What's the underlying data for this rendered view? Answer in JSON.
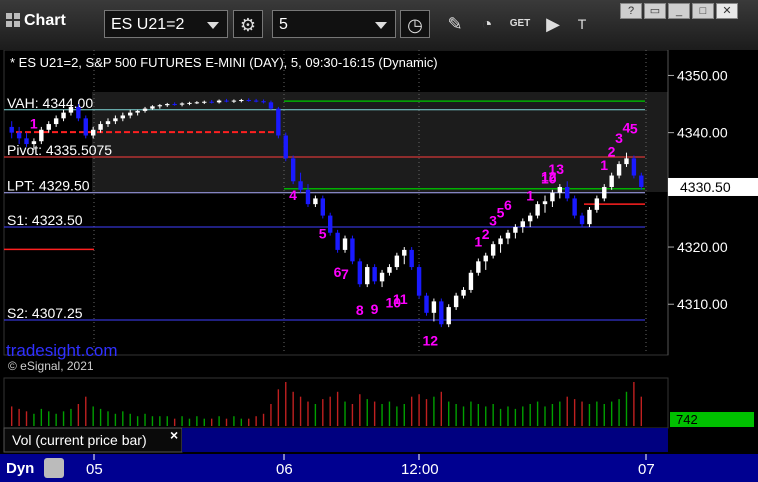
{
  "toolbar": {
    "title": "Chart",
    "symbol": "ES U21=2",
    "interval": "5",
    "icons": [
      "settings-gear-icon",
      "clock-icon",
      "draw-pen-icon",
      "indicator-icon",
      "get-icon",
      "play-icon",
      "text-tool-icon"
    ],
    "window_buttons": [
      "restore-icon",
      "tile-icon",
      "minimize-icon",
      "close-icon"
    ]
  },
  "chart_header": "* ES U21=2, S&P 500 FUTURES E-MINI (DAY), 5, 09:30-16:15 (Dynamic)",
  "watermark": "tradesight.com",
  "copyright": "© eSignal, 2021",
  "vol_panel_label": "Vol (current price bar)",
  "vol_value": "742",
  "bottom_bar_label": "Dyn",
  "x_axis_labels": [
    "05",
    "06",
    "12:00",
    "07"
  ],
  "colors": {
    "up": "#ffffff",
    "down": "#1a1aff",
    "pink": "#ff00ff",
    "green": "#009000",
    "bg": "#000000"
  },
  "chart_data": {
    "type": "candlestick",
    "title": "ES U21=2, S&P 500 FUTURES E-MINI (DAY), 5, 09:30-16:15 (Dynamic)",
    "ylim": [
      4302,
      4352
    ],
    "y_ticks": [
      4310.0,
      4320.0,
      4330.0,
      4340.0,
      4350.0
    ],
    "last_price": 4330.5,
    "levels": [
      {
        "label": "VAH: 4344.00",
        "value": 4344.0,
        "color": "#7fd6d6"
      },
      {
        "label": "Pivot: 4335.5075",
        "value": 4335.75,
        "color": "#ff3c3c"
      },
      {
        "label": "LPT: 4329.50",
        "value": 4329.5,
        "color": "#b0b0ff"
      },
      {
        "label": "S1: 4323.50",
        "value": 4323.5,
        "color": "#4040ff"
      },
      {
        "label": "S2: 4307.25",
        "value": 4307.25,
        "color": "#4040ff"
      }
    ],
    "extra_lines": [
      {
        "value": 4345.5,
        "color": "#00b000"
      },
      {
        "value": 4330.2,
        "color": "#00b000"
      },
      {
        "value": 4319.6,
        "color": "#ff2020"
      },
      {
        "value": 4340.1,
        "color": "#ff2020"
      },
      {
        "value": 4327.5,
        "color": "#ff2020"
      }
    ],
    "candles": [
      [
        4341,
        4342,
        4339,
        4340
      ],
      [
        4340,
        4341,
        4338,
        4339
      ],
      [
        4339,
        4340,
        4337.5,
        4338
      ],
      [
        4338,
        4339,
        4337,
        4338.5
      ],
      [
        4338.5,
        4341,
        4338,
        4340.5
      ],
      [
        4340.5,
        4342,
        4340,
        4341.5
      ],
      [
        4341.5,
        4343,
        4341,
        4342.5
      ],
      [
        4342.5,
        4344,
        4342,
        4343.5
      ],
      [
        4343.5,
        4345,
        4343,
        4344.5
      ],
      [
        4344.5,
        4345,
        4342,
        4342.5
      ],
      [
        4342.5,
        4343,
        4339,
        4339.5
      ],
      [
        4339.5,
        4341,
        4339,
        4340.5
      ],
      [
        4340.5,
        4342,
        4340,
        4341.5
      ],
      [
        4341.5,
        4342.5,
        4341,
        4342
      ],
      [
        4342,
        4343,
        4341.5,
        4342.5
      ],
      [
        4342.5,
        4343.5,
        4342,
        4343
      ],
      [
        4343,
        4344,
        4342.5,
        4343.5
      ],
      [
        4343.5,
        4344,
        4343,
        4343.8
      ],
      [
        4343.8,
        4344.5,
        4343.5,
        4344.2
      ],
      [
        4344.2,
        4344.8,
        4344,
        4344.6
      ],
      [
        4344.6,
        4345,
        4344.2,
        4344.8
      ],
      [
        4344.8,
        4345.2,
        4344.5,
        4345
      ],
      [
        4345,
        4345.3,
        4344.7,
        4344.9
      ],
      [
        4344.9,
        4345.3,
        4344.6,
        4345.1
      ],
      [
        4345.1,
        4345.4,
        4344.8,
        4345.2
      ],
      [
        4345.2,
        4345.5,
        4345,
        4345.3
      ],
      [
        4345.3,
        4345.6,
        4345,
        4345.4
      ],
      [
        4345.4,
        4345.7,
        4345.1,
        4345.3
      ],
      [
        4345.3,
        4345.8,
        4345.1,
        4345.6
      ],
      [
        4345.6,
        4345.9,
        4345.3,
        4345.5
      ],
      [
        4345.5,
        4345.8,
        4345.2,
        4345.6
      ],
      [
        4345.6,
        4345.9,
        4345.3,
        4345.7
      ],
      [
        4345.7,
        4346,
        4345.4,
        4345.6
      ],
      [
        4345.6,
        4345.9,
        4345.3,
        4345.5
      ],
      [
        4345.5,
        4345.8,
        4345.1,
        4345.3
      ],
      [
        4345.3,
        4345.6,
        4344,
        4344.2
      ],
      [
        4344.2,
        4344.5,
        4339,
        4339.5
      ],
      [
        4339.5,
        4340,
        4335,
        4335.5
      ],
      [
        4335.5,
        4336,
        4331,
        4331.5
      ],
      [
        4331.5,
        4333,
        4329.5,
        4330
      ],
      [
        4330,
        4331,
        4327,
        4327.5
      ],
      [
        4327.5,
        4329,
        4327,
        4328.5
      ],
      [
        4328.5,
        4329,
        4325,
        4325.5
      ],
      [
        4325.5,
        4326,
        4322,
        4322.5
      ],
      [
        4322.5,
        4323,
        4319,
        4319.5
      ],
      [
        4319.5,
        4322,
        4319,
        4321.5
      ],
      [
        4321.5,
        4322,
        4317,
        4317.5
      ],
      [
        4317.5,
        4318,
        4313,
        4313.5
      ],
      [
        4313.5,
        4317,
        4313,
        4316.5
      ],
      [
        4316.5,
        4317,
        4313.5,
        4314
      ],
      [
        4314,
        4316,
        4313,
        4315.5
      ],
      [
        4315.5,
        4317,
        4315,
        4316.5
      ],
      [
        4316.5,
        4319,
        4316,
        4318.5
      ],
      [
        4318.5,
        4320,
        4317,
        4319.5
      ],
      [
        4319.5,
        4320,
        4316,
        4316.5
      ],
      [
        4316.5,
        4317,
        4311,
        4311.5
      ],
      [
        4311.5,
        4312,
        4308,
        4308.5
      ],
      [
        4308.5,
        4311,
        4307,
        4310.5
      ],
      [
        4310.5,
        4311,
        4306,
        4306.5
      ],
      [
        4306.5,
        4310,
        4306,
        4309.5
      ],
      [
        4309.5,
        4312,
        4309,
        4311.5
      ],
      [
        4311.5,
        4313,
        4311,
        4312.5
      ],
      [
        4312.5,
        4316,
        4312,
        4315.5
      ],
      [
        4315.5,
        4318,
        4315,
        4317.5
      ],
      [
        4317.5,
        4319,
        4316,
        4318.5
      ],
      [
        4318.5,
        4321,
        4318,
        4320.5
      ],
      [
        4320.5,
        4322,
        4319,
        4321.5
      ],
      [
        4321.5,
        4323,
        4320.5,
        4322.5
      ],
      [
        4322.5,
        4324,
        4321.5,
        4323.5
      ],
      [
        4323.5,
        4325,
        4322.5,
        4324.5
      ],
      [
        4324.5,
        4326,
        4323.5,
        4325.5
      ],
      [
        4325.5,
        4328,
        4325,
        4327.5
      ],
      [
        4327.5,
        4329,
        4326,
        4328
      ],
      [
        4328,
        4330,
        4327,
        4329.5
      ],
      [
        4329.5,
        4331,
        4328.5,
        4330.5
      ],
      [
        4330.5,
        4331.5,
        4328,
        4328.5
      ],
      [
        4328.5,
        4329,
        4325,
        4325.5
      ],
      [
        4325.5,
        4326,
        4323.5,
        4324
      ],
      [
        4324,
        4327,
        4323.5,
        4326.5
      ],
      [
        4326.5,
        4329,
        4326,
        4328.5
      ],
      [
        4328.5,
        4331,
        4328,
        4330.5
      ],
      [
        4330.5,
        4333,
        4330,
        4332.5
      ],
      [
        4332.5,
        4335,
        4332,
        4334.5
      ],
      [
        4334.5,
        4336.5,
        4334,
        4335.5
      ],
      [
        4335.5,
        4336,
        4332,
        4332.5
      ],
      [
        4332.5,
        4333,
        4330,
        4330.5
      ]
    ],
    "volume": [
      8,
      7,
      6,
      5,
      7,
      6,
      5,
      6,
      7,
      9,
      12,
      8,
      7,
      6,
      5,
      6,
      5,
      4,
      5,
      4,
      4,
      4,
      3,
      4,
      3,
      4,
      3,
      3,
      4,
      3,
      4,
      3,
      3,
      4,
      5,
      9,
      15,
      18,
      14,
      12,
      10,
      9,
      11,
      12,
      14,
      10,
      9,
      13,
      11,
      10,
      9,
      10,
      8,
      9,
      12,
      13,
      11,
      12,
      14,
      10,
      9,
      8,
      10,
      9,
      8,
      9,
      7,
      8,
      7,
      8,
      9,
      10,
      8,
      9,
      10,
      12,
      11,
      10,
      9,
      10,
      9,
      10,
      11,
      14,
      18,
      12
    ],
    "vol_colors": "green_up_red_down"
  },
  "count_labels": [
    {
      "t": "1",
      "color": "pink"
    },
    {
      "t": "4",
      "color": "pink"
    },
    {
      "t": "5",
      "color": "pink"
    },
    {
      "t": "6",
      "color": "pink"
    },
    {
      "t": "7",
      "color": "pink"
    },
    {
      "t": "8",
      "color": "pink"
    },
    {
      "t": "9",
      "color": "pink"
    },
    {
      "t": "10",
      "color": "pink"
    },
    {
      "t": "11",
      "color": "pink"
    },
    {
      "t": "12",
      "color": "pink"
    },
    {
      "t": "1",
      "color": "pink"
    },
    {
      "t": "2",
      "color": "pink"
    },
    {
      "t": "3",
      "color": "pink"
    },
    {
      "t": "5",
      "color": "pink"
    },
    {
      "t": "6",
      "color": "pink"
    },
    {
      "t": "1",
      "color": "pink"
    },
    {
      "t": "12",
      "color": "pink"
    },
    {
      "t": "13",
      "color": "pink"
    },
    {
      "t": "1",
      "color": "pink"
    },
    {
      "t": "2",
      "color": "pink"
    },
    {
      "t": "3",
      "color": "pink"
    },
    {
      "t": "4",
      "color": "pink"
    },
    {
      "t": "5",
      "color": "pink"
    },
    {
      "t": "10",
      "color": "pink"
    }
  ]
}
